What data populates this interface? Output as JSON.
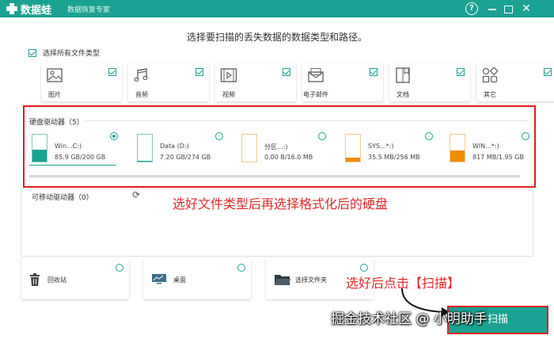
{
  "app": {
    "name": "数据蛙",
    "subtitle": "数据恢复专家"
  },
  "titlebar": {
    "help": "?",
    "close": "✕"
  },
  "heading": "选择要扫描的丢失数据的数据类型和路径。",
  "select_all": {
    "label": "选择所有文件类型",
    "checked": true
  },
  "file_types": [
    {
      "label": "图片",
      "icon": "image-icon",
      "checked": true
    },
    {
      "label": "音频",
      "icon": "music-icon",
      "checked": true
    },
    {
      "label": "视频",
      "icon": "video-icon",
      "checked": true
    },
    {
      "label": "电子邮件",
      "icon": "email-icon",
      "checked": true
    },
    {
      "label": "文档",
      "icon": "document-icon",
      "checked": true
    },
    {
      "label": "其它",
      "icon": "other-icon",
      "checked": true
    }
  ],
  "hard_drives": {
    "title": "硬盘驱动器（5）",
    "items": [
      {
        "name": "Win...C:)",
        "size": "85.9 GB/200 GB",
        "selected": true,
        "usage": 0.43,
        "color": "#1ba292"
      },
      {
        "name": "Data (D:)",
        "size": "7.20 GB/274 GB",
        "selected": false,
        "usage": 0.03,
        "color": "#1ba292"
      },
      {
        "name": "分区...:)",
        "size": "0.00  B/16.0 MB",
        "selected": false,
        "usage": 0.0,
        "color": "#f08c00"
      },
      {
        "name": "SYS...*:)",
        "size": "35.5 MB/256 MB",
        "selected": false,
        "usage": 0.14,
        "color": "#f08c00"
      },
      {
        "name": "WIN...*:)",
        "size": "817 MB/1.95 GB",
        "selected": false,
        "usage": 0.42,
        "color": "#f08c00"
      }
    ]
  },
  "removable": {
    "title": "可移动驱动器（0）"
  },
  "annotations": {
    "select_drive": "选好文件类型后再选择格式化后的硬盘",
    "click_scan": "选好后点击【扫描】"
  },
  "locations": [
    {
      "label": "回收站",
      "icon": "trash-icon"
    },
    {
      "label": "桌面",
      "icon": "desktop-icon"
    },
    {
      "label": "选择文件夹",
      "icon": "folder-icon"
    }
  ],
  "scan_button": "扫描",
  "watermark": "掘金技术社区 @ 小明助手",
  "colors": {
    "brand": "#1ba292",
    "annotation_red": "#e22a2a",
    "partition_orange": "#f08c00"
  }
}
